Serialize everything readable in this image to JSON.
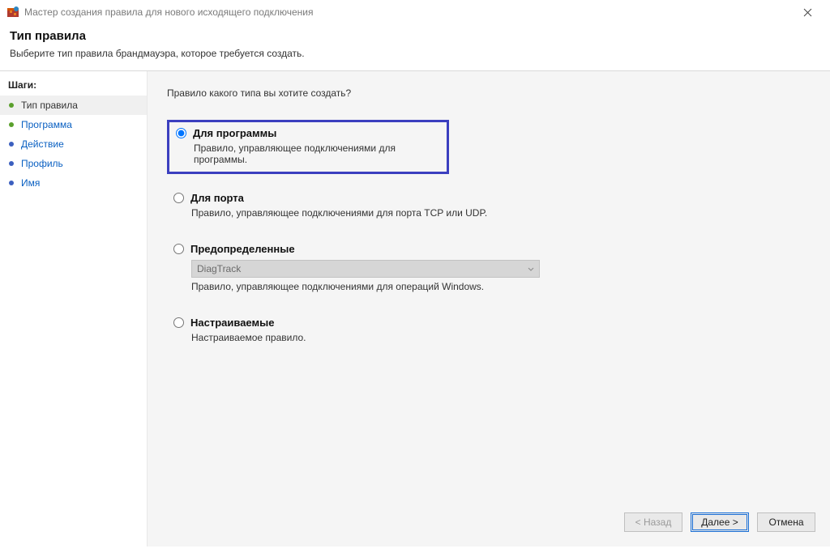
{
  "window": {
    "title": "Мастер создания правила для нового исходящего подключения"
  },
  "header": {
    "title": "Тип правила",
    "subtitle": "Выберите тип правила брандмауэра, которое требуется создать."
  },
  "sidebar": {
    "heading": "Шаги:",
    "steps": [
      {
        "label": "Тип правила"
      },
      {
        "label": "Программа"
      },
      {
        "label": "Действие"
      },
      {
        "label": "Профиль"
      },
      {
        "label": "Имя"
      }
    ]
  },
  "main": {
    "question": "Правило какого типа вы хотите создать?",
    "options": {
      "program": {
        "label": "Для программы",
        "desc": "Правило, управляющее подключениями для программы."
      },
      "port": {
        "label": "Для порта",
        "desc": "Правило, управляющее подключениями для порта TCP или UDP."
      },
      "predefined": {
        "label": "Предопределенные",
        "select_value": "DiagTrack",
        "desc": "Правило, управляющее подключениями для операций Windows."
      },
      "custom": {
        "label": "Настраиваемые",
        "desc": "Настраиваемое правило."
      }
    }
  },
  "buttons": {
    "back": "< Назад",
    "next": "Далее >",
    "cancel": "Отмена"
  }
}
